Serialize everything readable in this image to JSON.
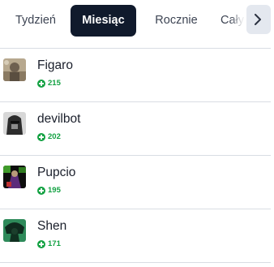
{
  "tabs": [
    {
      "label": "Tydzień",
      "active": false
    },
    {
      "label": "Miesiąc",
      "active": true
    },
    {
      "label": "Rocznie",
      "active": false
    },
    {
      "label": "Cały",
      "active": false
    }
  ],
  "scroll_button": {
    "icon": "chevron-right-icon"
  },
  "colors": {
    "active_tab_bg": "#101a2c",
    "score_green": "#12a142",
    "scroll_btn_bg": "#e4e8ef"
  },
  "ranking": [
    {
      "name": "Figaro",
      "points": "215"
    },
    {
      "name": "devilbot",
      "points": "202"
    },
    {
      "name": "Pupcio",
      "points": "195"
    },
    {
      "name": "Shen",
      "points": "171"
    }
  ]
}
